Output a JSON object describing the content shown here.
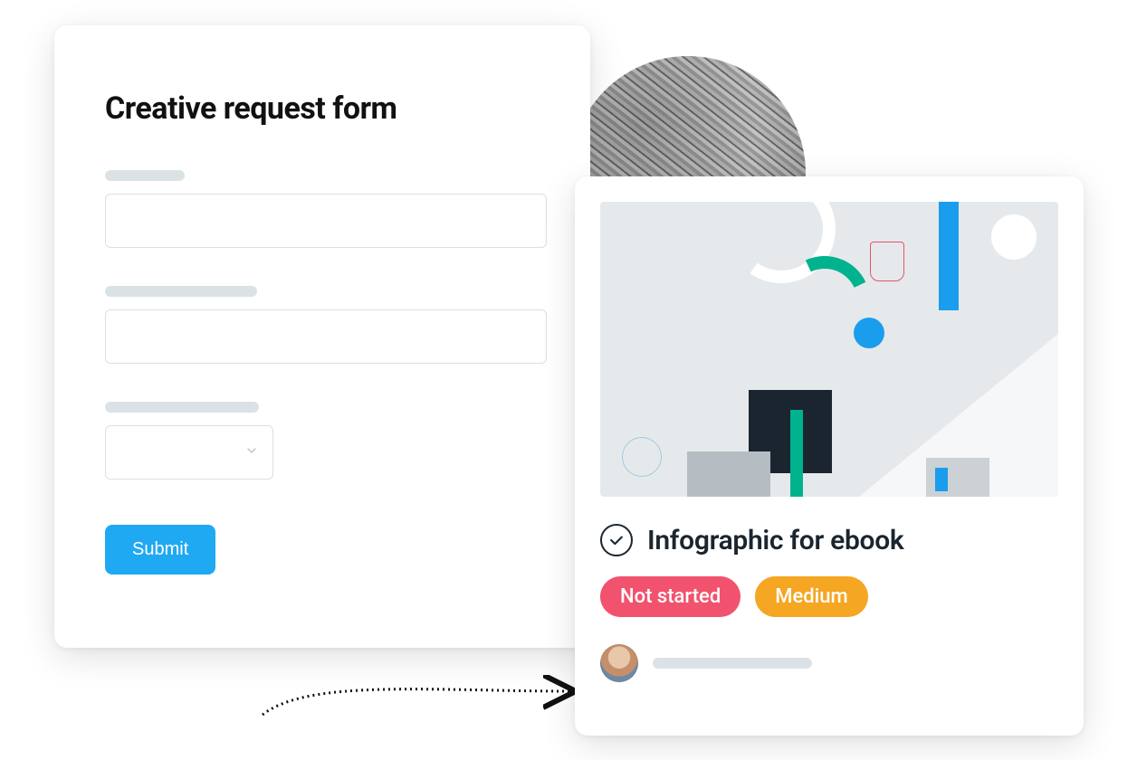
{
  "form": {
    "title": "Creative request form",
    "field1": {
      "value": ""
    },
    "field2": {
      "value": ""
    },
    "select": {
      "value": ""
    },
    "submit_label": "Submit"
  },
  "task": {
    "title": "Infographic for ebook",
    "status": "Not started",
    "priority": "Medium"
  },
  "colors": {
    "primary_button": "#20a9f3",
    "status_tag": "#f1536e",
    "priority_tag": "#f5a623",
    "accent_green": "#00b28e",
    "accent_blue": "#1b9ded"
  }
}
